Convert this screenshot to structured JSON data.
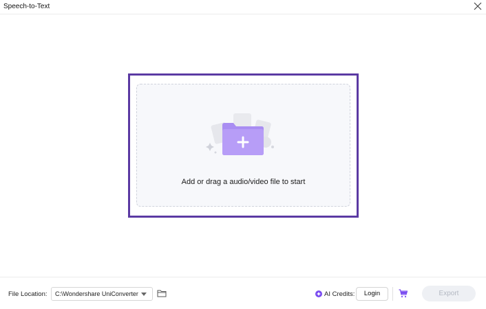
{
  "window": {
    "title": "Speech-to-Text",
    "close_icon": "close-icon"
  },
  "dropzone": {
    "prompt": "Add or drag a audio/video file to start",
    "icon": "folder-plus-icon"
  },
  "footer": {
    "file_location_label": "File Location:",
    "file_location_value": "C:\\Wondershare UniConverter",
    "ai_credits_label": "AI Credits:",
    "login_label": "Login",
    "export_label": "Export"
  },
  "colors": {
    "accent": "#8a5cf0",
    "highlight_border": "#5b3aa3",
    "export_disabled_bg": "#eef0f4",
    "export_disabled_text": "#b3b8c2"
  }
}
